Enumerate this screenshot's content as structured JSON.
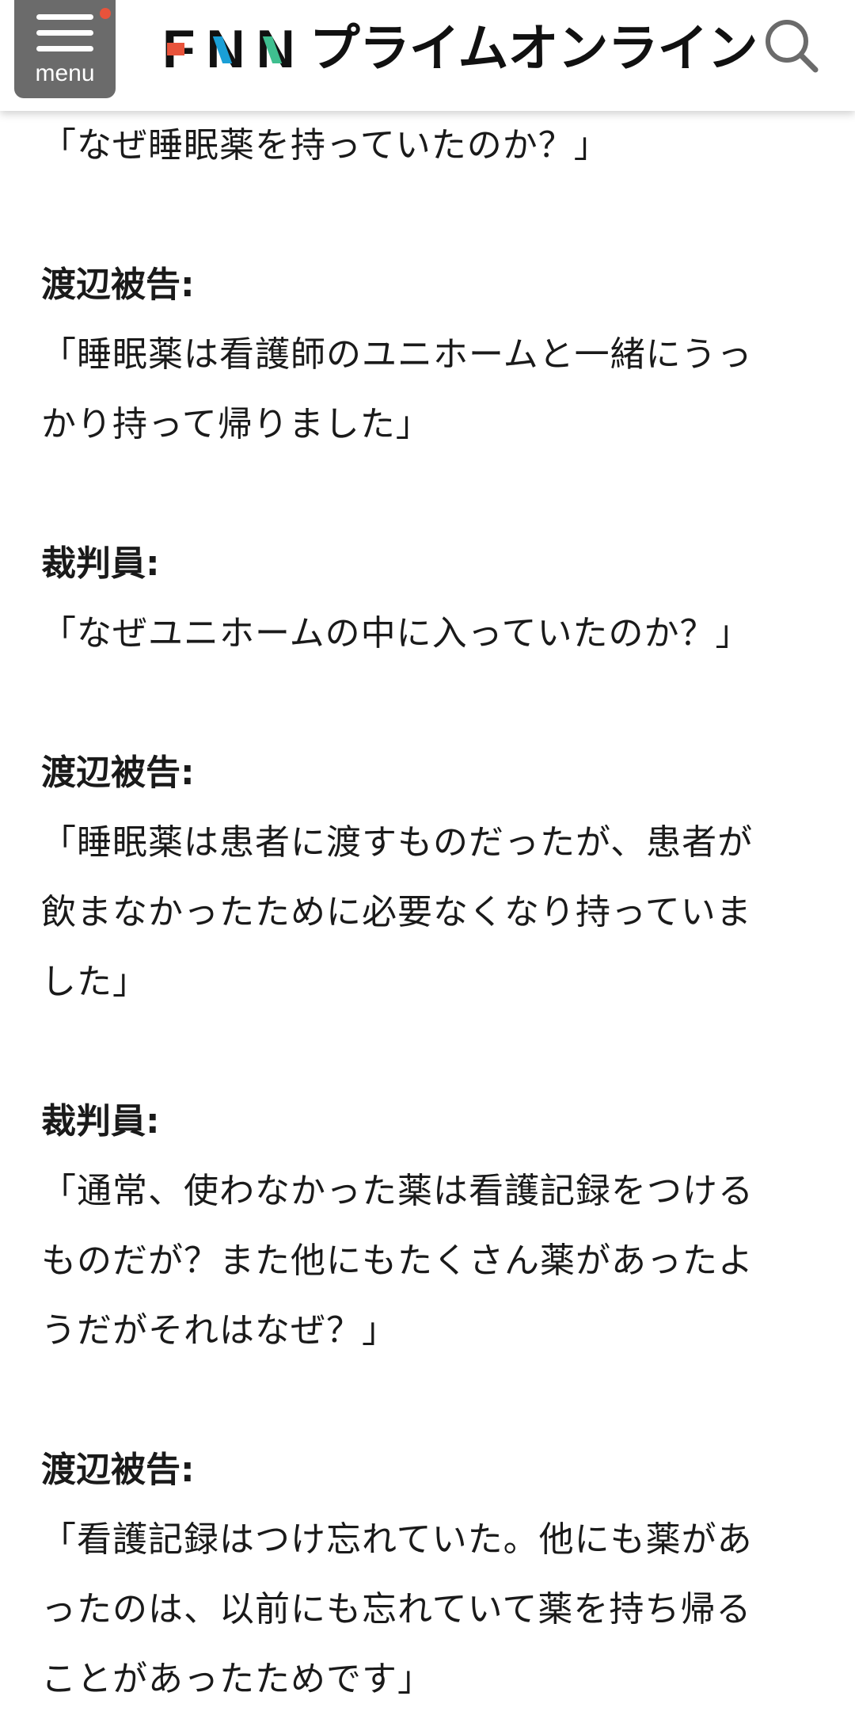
{
  "header": {
    "menu_label": "menu",
    "logo_letters": [
      "F",
      "N",
      "N"
    ],
    "logo_text": "プライムオンライン",
    "accent_colors": {
      "menu_dot": "#e8533b",
      "logo_f": "#e8533b",
      "logo_n1": "#1a9fd6",
      "logo_n2": "#3fbf8f"
    }
  },
  "article": {
    "lines": [
      "「なぜ睡眠薬を持っていたのか？」",
      "",
      "渡辺被告:",
      "「睡眠薬は看護師のユニホームと一緒にうっ",
      "かり持って帰りました」",
      "",
      "裁判員:",
      "「なぜユニホームの中に入っていたのか？」",
      "",
      "渡辺被告:",
      "「睡眠薬は患者に渡すものだったが、患者が",
      "飲まなかったために必要なくなり持っていま",
      "した」",
      "",
      "裁判員:",
      "「通常、使わなかった薬は看護記録をつける",
      "ものだが？また他にもたくさん薬があったよ",
      "うだがそれはなぜ？」",
      "",
      "渡辺被告:",
      "「看護記録はつけ忘れていた。他にも薬があ",
      "ったのは、以前にも忘れていて薬を持ち帰る",
      "ことがあったためです」"
    ]
  }
}
